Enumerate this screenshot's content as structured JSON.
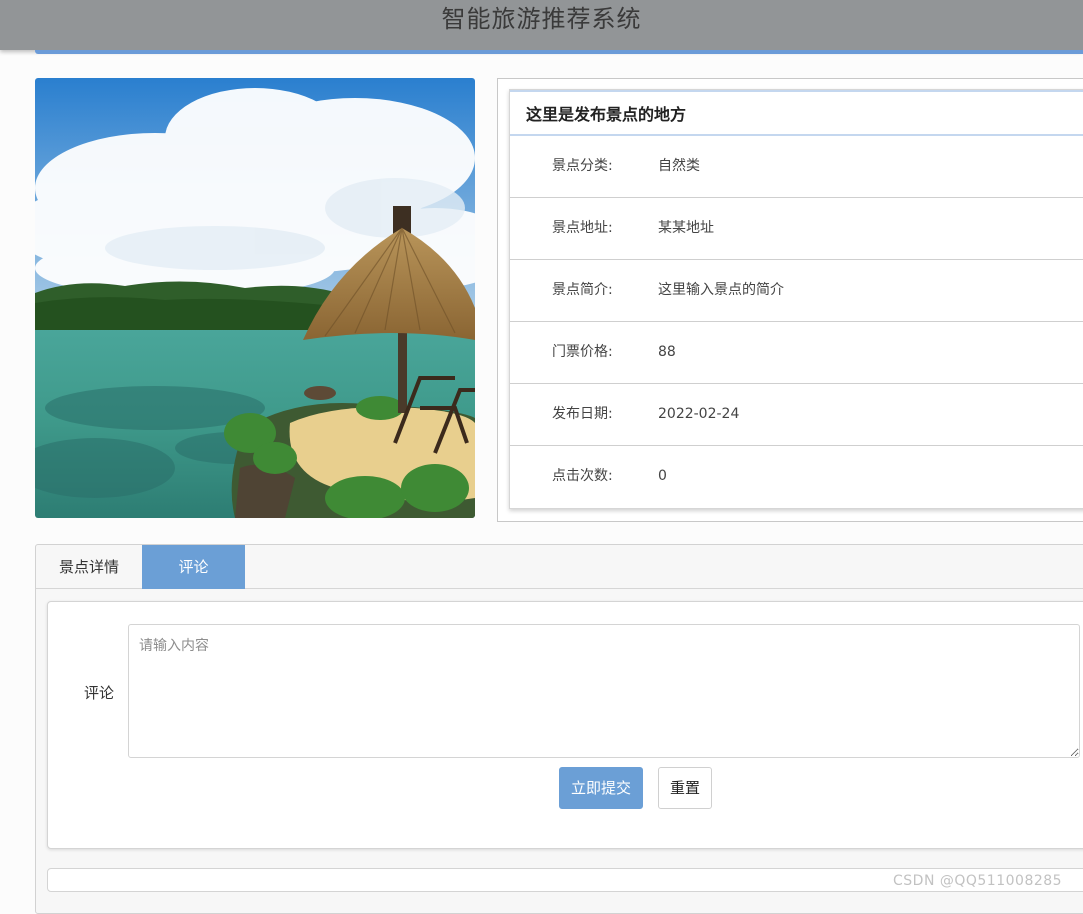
{
  "header": {
    "title": "智能旅游推荐系统"
  },
  "scene": {
    "description_icon": "beach-scene-image"
  },
  "info": {
    "title": "这里是发布景点的地方",
    "rows": [
      {
        "label": "景点分类:",
        "value": "自然类"
      },
      {
        "label": "景点地址:",
        "value": "某某地址"
      },
      {
        "label": "景点简介:",
        "value": "这里输入景点的简介"
      },
      {
        "label": "门票价格:",
        "value": "88"
      },
      {
        "label": "发布日期:",
        "value": "2022-02-24"
      },
      {
        "label": "点击次数:",
        "value": "0"
      }
    ]
  },
  "tabs": {
    "detail": "景点详情",
    "comment": "评论",
    "active": "comment"
  },
  "form": {
    "label": "评论",
    "placeholder": "请输入内容",
    "value": "",
    "submit_label": "立即提交",
    "reset_label": "重置"
  },
  "watermark": "CSDN @QQ511008285",
  "colors": {
    "accent": "#6b9fd6",
    "header_bg": "#929597"
  }
}
